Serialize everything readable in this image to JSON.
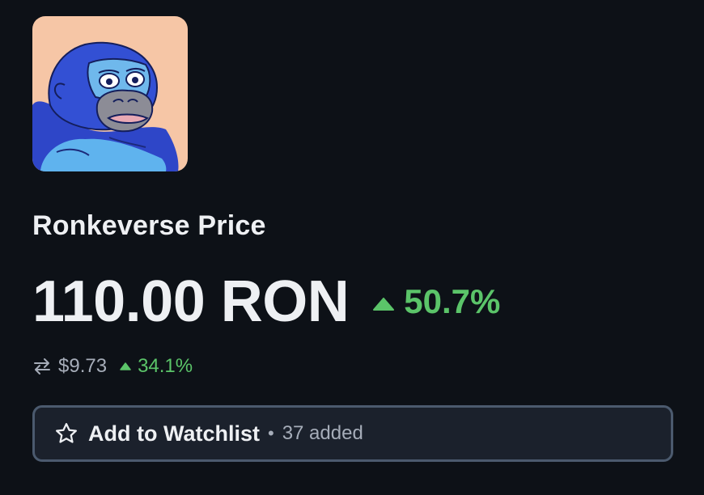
{
  "token": {
    "avatar_icon": "blue-ape-avatar",
    "title": "Ronkeverse Price",
    "price": "110.00 RON",
    "change_pct": "50.7%",
    "usd_price": "$9.73",
    "usd_change_pct": "34.1%"
  },
  "watchlist": {
    "label": "Add to Watchlist",
    "separator": "•",
    "added_text": "37 added"
  },
  "colors": {
    "background": "#0d1117",
    "text": "#eef0f3",
    "muted": "#a6adb9",
    "positive": "#5bc469",
    "button_bg": "#1b212c",
    "button_border": "#4b5a6e",
    "avatar_bg": "#f6c6a6"
  }
}
